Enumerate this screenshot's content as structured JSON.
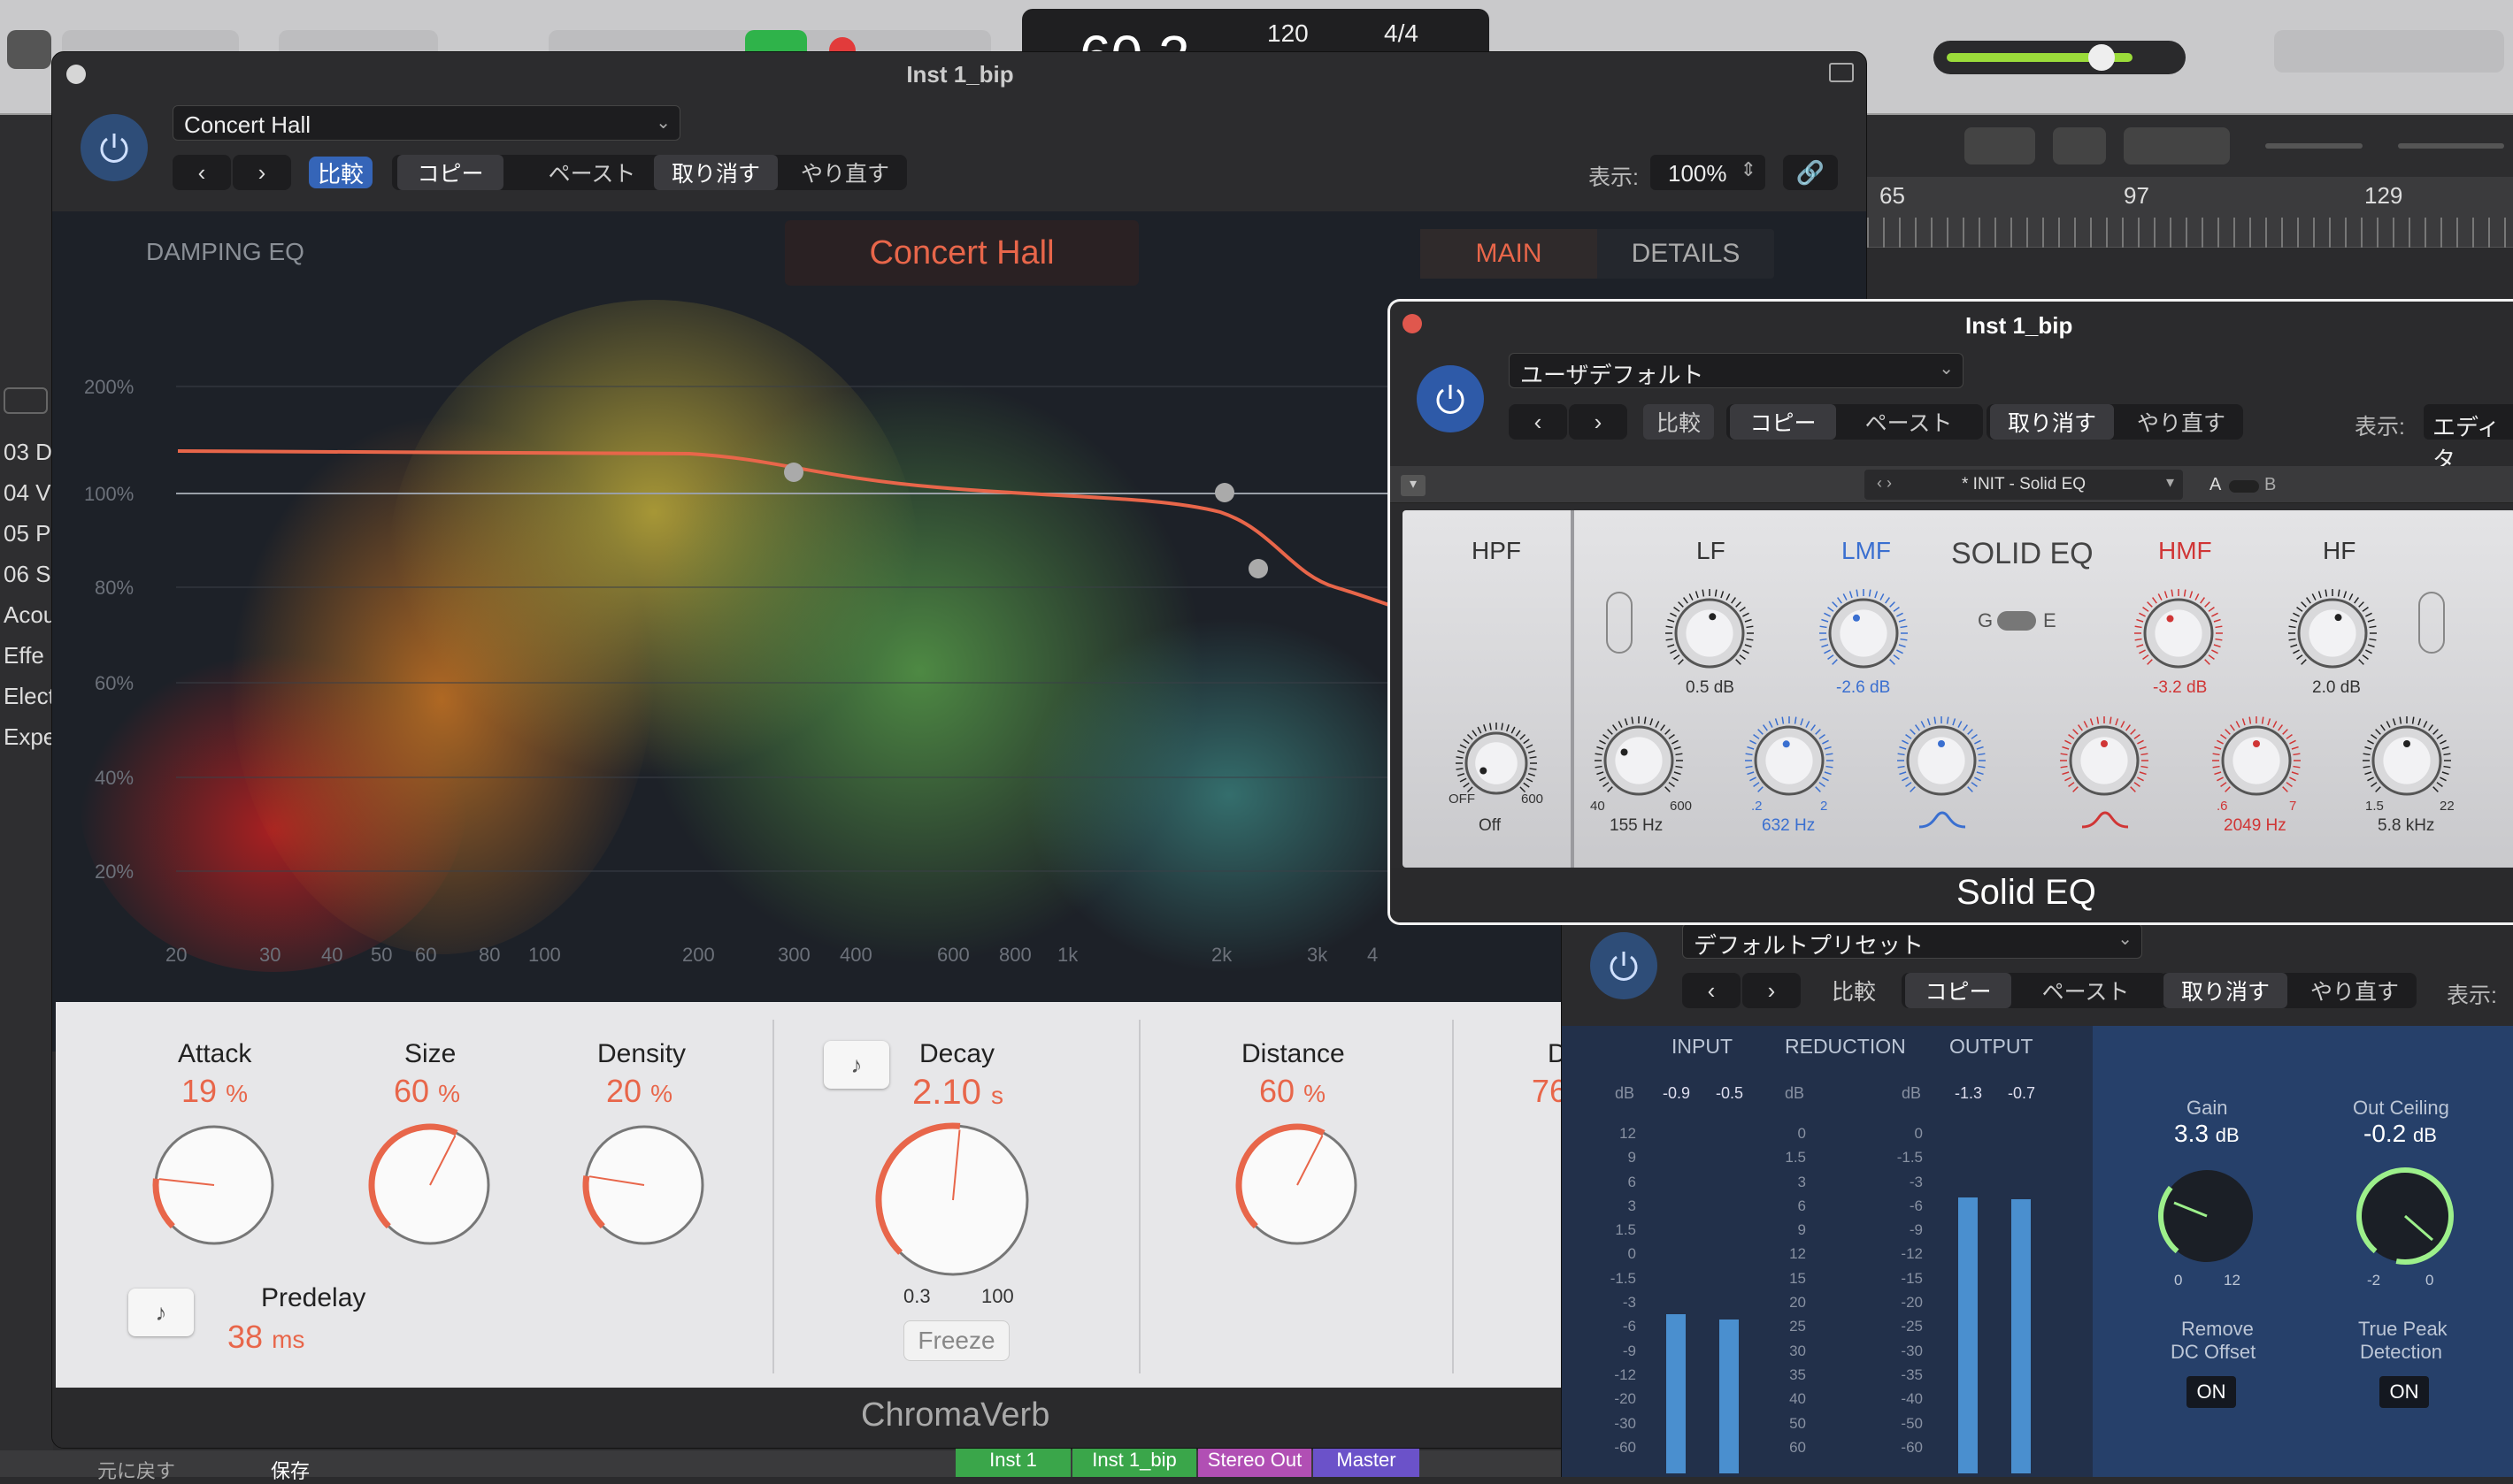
{
  "daw": {
    "toolbar": {
      "counter": "60 2",
      "tempo": "120",
      "signature": "4/4"
    },
    "ruler": [
      "65",
      "97",
      "129"
    ],
    "sidebar": [
      "03 D",
      "04 V",
      "05 P",
      "06 S",
      "Acou",
      "Effe",
      "Elect",
      "Expe"
    ],
    "bottom": {
      "back": "元に戻す",
      "save": "保存",
      "tracks": [
        "Inst 1",
        "Inst 1_bip",
        "Stereo Out",
        "Master"
      ]
    }
  },
  "chromaverb": {
    "window_title": "Inst 1_bip",
    "preset": "Concert Hall",
    "header": {
      "compare": "比較",
      "copy": "コピー",
      "paste": "ペースト",
      "undo": "取り消す",
      "redo": "やり直す",
      "view_label": "表示:",
      "zoom": "100%"
    },
    "damping_label": "DAMPING EQ",
    "preset_display": "Concert Hall",
    "tabs": [
      "MAIN",
      "DETAILS"
    ],
    "y_ticks": [
      "200%",
      "100%",
      "80%",
      "60%",
      "40%",
      "20%"
    ],
    "x_ticks": [
      "20",
      "30",
      "40",
      "50",
      "60",
      "80",
      "100",
      "200",
      "300",
      "400",
      "600",
      "800",
      "1k",
      "2k",
      "3k",
      "4"
    ],
    "params": {
      "attack": {
        "label": "Attack",
        "value": "19",
        "unit": "%",
        "fraction": 0.19
      },
      "size": {
        "label": "Size",
        "value": "60",
        "unit": "%",
        "fraction": 0.6
      },
      "density": {
        "label": "Density",
        "value": "20",
        "unit": "%",
        "fraction": 0.2
      },
      "predelay": {
        "label": "Predelay",
        "value": "38",
        "unit": "ms"
      },
      "decay": {
        "label": "Decay",
        "value": "2.10",
        "unit": "s",
        "min": "0.3",
        "max": "100",
        "fraction": 0.52
      },
      "distance": {
        "label": "Distance",
        "value": "60",
        "unit": "%",
        "fraction": 0.6
      },
      "cut": {
        "label": "D",
        "value": "76"
      }
    },
    "freeze": "Freeze",
    "name": "ChromaVerb"
  },
  "solideq": {
    "window_title": "Inst 1_bip",
    "preset": "ユーザデフォルト",
    "header": {
      "compare": "比較",
      "copy": "コピー",
      "paste": "ペースト",
      "undo": "取り消す",
      "redo": "やり直す",
      "view_label": "表示:",
      "view_value": "エディタ"
    },
    "preset_bar": "* INIT - Solid EQ",
    "ab_a": "A",
    "ab_b": "B",
    "title": "SOLID EQ",
    "ge_g": "G",
    "ge_e": "E",
    "bands": {
      "hpf": "HPF",
      "lf": "LF",
      "lmf": "LMF",
      "hmf": "HMF",
      "hf": "HF"
    },
    "values": {
      "lf_gain": "0.5 dB",
      "lmf_gain": "-2.6 dB",
      "hmf_gain": "-3.2 dB",
      "hf_gain": "2.0 dB",
      "hpf_freq": "Off",
      "lf_freq": "155 Hz",
      "lmf_freq": "632 Hz",
      "hmf_freq": "2049 Hz",
      "hf_freq": "5.8 kHz"
    },
    "scale": {
      "off": "OFF",
      "n600": "600",
      "n40": "40",
      "n600b": "600",
      "n2": ".2",
      "n2b": "2",
      "n6": ".6",
      "n7": "7",
      "n15": "1.5",
      "n22": "22"
    },
    "name": "Solid EQ",
    "colors": {
      "lmf": "#3a6fd0",
      "hmf": "#d03535"
    }
  },
  "limiter": {
    "preset": "デフォルトプリセット",
    "header": {
      "compare": "比較",
      "copy": "コピー",
      "paste": "ペースト",
      "undo": "取り消す",
      "redo": "やり直す",
      "view_label": "表示:"
    },
    "meters": {
      "input": "INPUT",
      "reduction": "REDUCTION",
      "output": "OUTPUT",
      "db": "dB",
      "in_peaks": [
        "-0.9",
        "-0.5"
      ],
      "out_peaks": [
        "-1.3",
        "-0.7"
      ]
    },
    "scale_in": [
      "12",
      "9",
      "6",
      "3",
      "1.5",
      "0",
      "-1.5",
      "-3",
      "-6",
      "-9",
      "-12",
      "-20",
      "-30",
      "-60"
    ],
    "scale_red": [
      "0",
      "1.5",
      "3",
      "6",
      "9",
      "12",
      "15",
      "20",
      "25",
      "30",
      "35",
      "40",
      "50",
      "60"
    ],
    "scale_out": [
      "0",
      "-1.5",
      "-3",
      "-6",
      "-9",
      "-12",
      "-15",
      "-20",
      "-25",
      "-30",
      "-35",
      "-40",
      "-50",
      "-60"
    ],
    "gain": {
      "label": "Gain",
      "value": "3.3",
      "unit": "dB",
      "min": "0",
      "max": "12"
    },
    "ceiling": {
      "label": "Out Ceiling",
      "value": "-0.2",
      "unit": "dB",
      "min": "-2",
      "max": "0"
    },
    "dc": {
      "label1": "Remove",
      "label2": "DC Offset",
      "state": "ON"
    },
    "tp": {
      "label1": "True Peak",
      "label2": "Detection",
      "state": "ON"
    }
  }
}
